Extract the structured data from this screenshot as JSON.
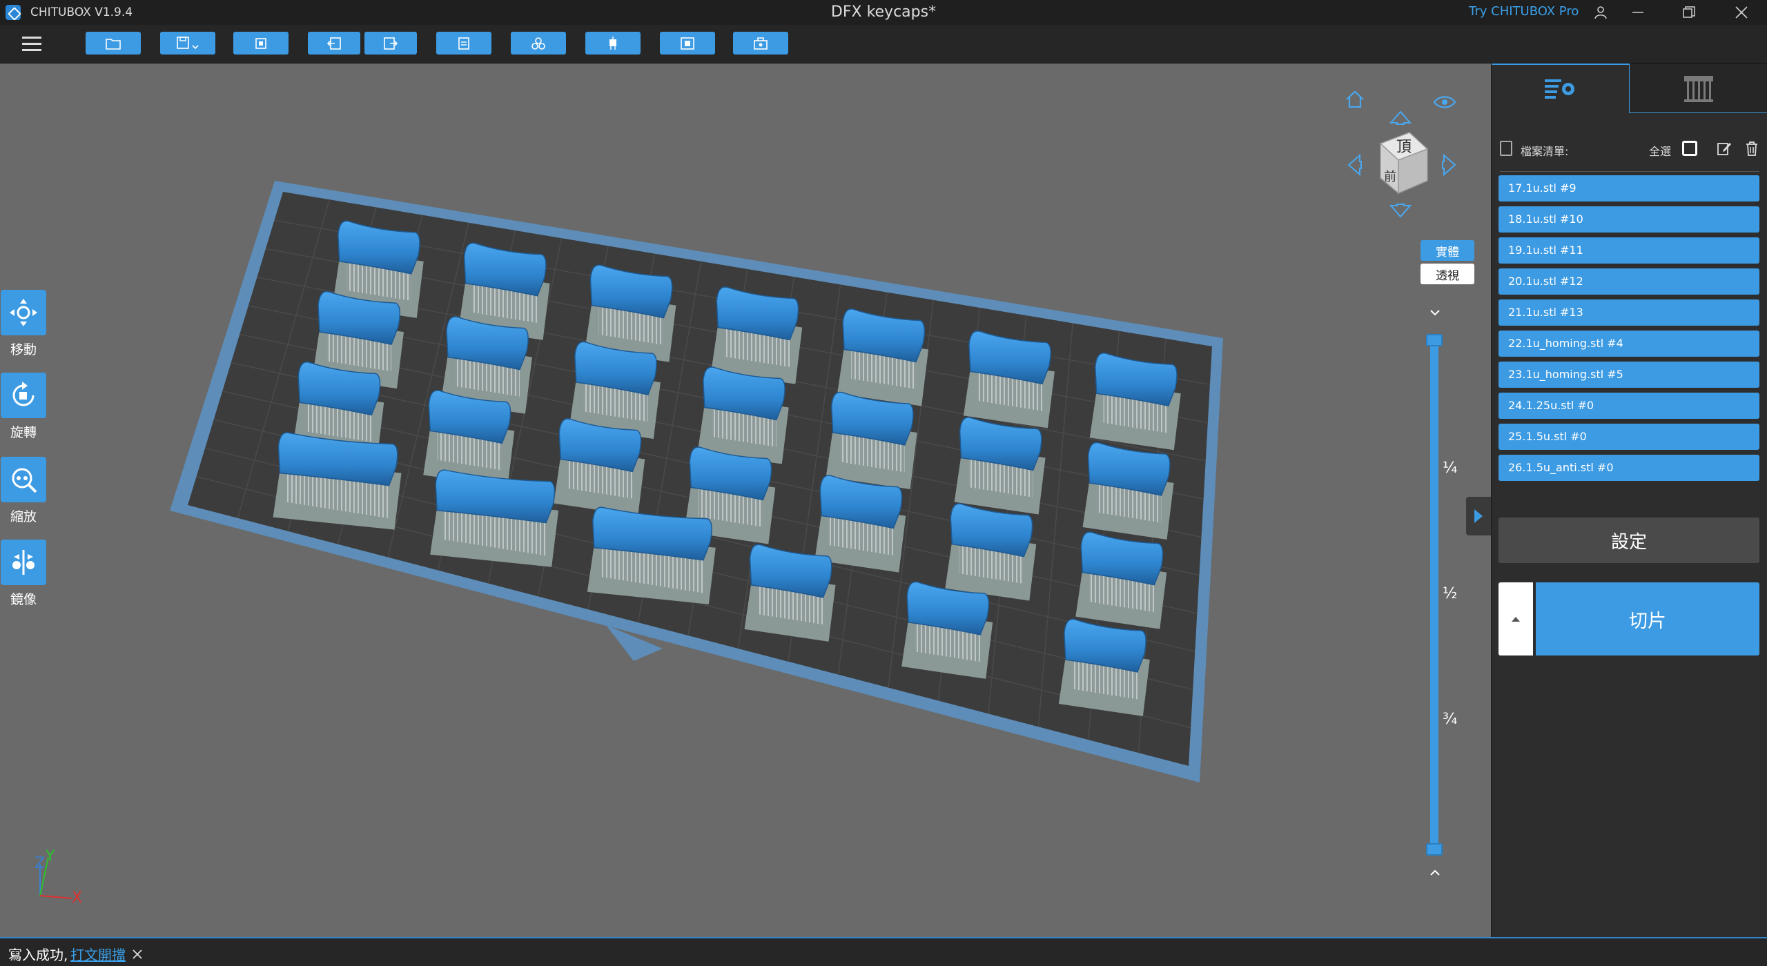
{
  "window": {
    "app_name": "CHITUBOX V1.9.4",
    "doc_title": "DFX keycaps*",
    "pro_link": "Try CHITUBOX Pro"
  },
  "toolbar": {
    "buttons": [
      "open-file",
      "save",
      "auto-layout",
      "undo",
      "redo",
      "copy",
      "arrange",
      "support",
      "hollow",
      "dig-hole"
    ]
  },
  "left_tools": [
    {
      "label": "移動",
      "icon": "move-icon"
    },
    {
      "label": "旋轉",
      "icon": "rotate-icon"
    },
    {
      "label": "縮放",
      "icon": "scale-icon"
    },
    {
      "label": "鏡像",
      "icon": "mirror-icon"
    }
  ],
  "nav_cube": {
    "top_face": "頂",
    "front_face": "前"
  },
  "view_modes": {
    "solid": "實體",
    "xray": "透視"
  },
  "slider_marks": [
    "¼",
    "½",
    "¾"
  ],
  "right_panel": {
    "file_list_title": "檔案清單:",
    "select_all": "全選",
    "files": [
      "17.1u.stl #9",
      "18.1u.stl #10",
      "19.1u.stl #11",
      "20.1u.stl #12",
      "21.1u.stl #13",
      "22.1u_homing.stl #4",
      "23.1u_homing.stl #5",
      "24.1.25u.stl #0",
      "25.1.5u.stl #0",
      "26.1.5u_anti.stl #0"
    ],
    "settings_label": "設定",
    "slice_label": "切片"
  },
  "axis": {
    "x": "X",
    "y": "Y",
    "z": "Z"
  },
  "status": {
    "message": "寫入成功,",
    "link": "打文開擋"
  },
  "colors": {
    "accent": "#3d9be3",
    "keycap": "#3a8fd6",
    "plate": "#7a8886",
    "viewport_bg": "#6a6a6a"
  }
}
